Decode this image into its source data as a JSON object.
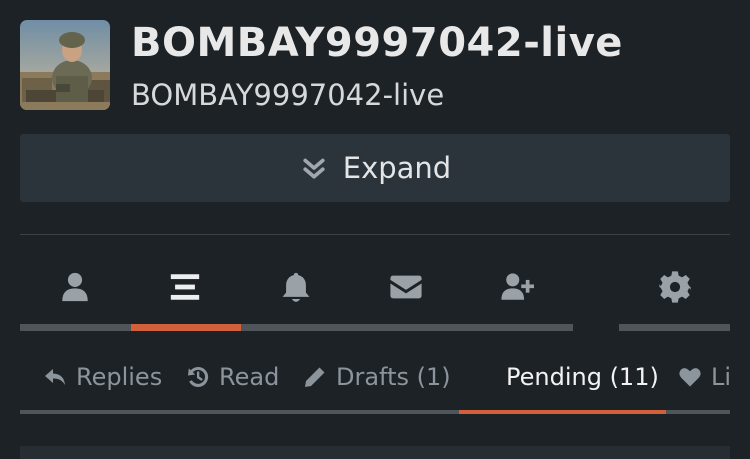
{
  "profile": {
    "title": "BOMBAY9997042-live",
    "subtitle": "BOMBAY9997042-live",
    "avatar_icon": "soldier-avatar-image"
  },
  "expand_button": {
    "label": "Expand",
    "icon": "double-chevron-down-icon"
  },
  "icon_tabs": [
    {
      "icon": "user-icon",
      "active": false
    },
    {
      "icon": "list-icon",
      "active": true
    },
    {
      "icon": "bell-icon",
      "active": false
    },
    {
      "icon": "envelope-icon",
      "active": false
    },
    {
      "icon": "user-plus-icon",
      "active": false
    },
    {
      "icon": "gear-icon",
      "active": false
    }
  ],
  "sub_tabs": [
    {
      "label": "Replies",
      "icon": "reply-icon",
      "active": false
    },
    {
      "label": "Read",
      "icon": "history-icon",
      "active": false
    },
    {
      "label": "Drafts (1)",
      "icon": "pencil-icon",
      "active": false
    },
    {
      "label": "Pending (11)",
      "icon": "",
      "active": true
    },
    {
      "label": "Li",
      "icon": "heart-icon",
      "active": false
    }
  ],
  "colors": {
    "background": "#1d2227",
    "accent": "#d2603a",
    "panel": "#2b343b",
    "muted_text": "#8c959c"
  }
}
